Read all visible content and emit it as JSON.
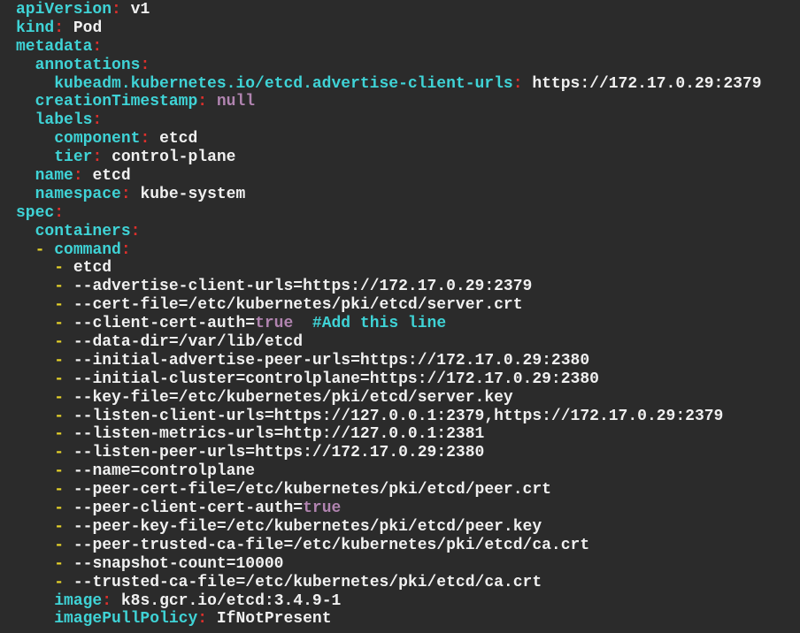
{
  "colors": {
    "background": "#2b2b2b",
    "key": "#3fd3d6",
    "colon": "#e0302c",
    "dash": "#e6d22a",
    "literal": "#b184b0",
    "text": "#f0f0f0"
  },
  "lines": [
    {
      "indent": 0,
      "key": "apiVersion",
      "value": "v1"
    },
    {
      "indent": 0,
      "key": "kind",
      "value": "Pod"
    },
    {
      "indent": 0,
      "key": "metadata"
    },
    {
      "indent": 1,
      "key": "annotations"
    },
    {
      "indent": 2,
      "key": "kubeadm.kubernetes.io/etcd.advertise-client-urls",
      "value": "https://172.17.0.29:2379"
    },
    {
      "indent": 1,
      "key": "creationTimestamp",
      "literal": "null"
    },
    {
      "indent": 1,
      "key": "labels"
    },
    {
      "indent": 2,
      "key": "component",
      "value": "etcd"
    },
    {
      "indent": 2,
      "key": "tier",
      "value": "control-plane"
    },
    {
      "indent": 1,
      "key": "name",
      "value": "etcd"
    },
    {
      "indent": 1,
      "key": "namespace",
      "value": "kube-system"
    },
    {
      "indent": 0,
      "key": "spec"
    },
    {
      "indent": 1,
      "key": "containers"
    },
    {
      "indent": 1,
      "dash": true,
      "key": "command"
    },
    {
      "indent": 2,
      "dash": true,
      "value": "etcd"
    },
    {
      "indent": 2,
      "dash": true,
      "value": "--advertise-client-urls=https://172.17.0.29:2379"
    },
    {
      "indent": 2,
      "dash": true,
      "value": "--cert-file=/etc/kubernetes/pki/etcd/server.crt"
    },
    {
      "indent": 2,
      "dash": true,
      "value": "--client-cert-auth=",
      "literal": "true",
      "comment": "  #Add this line"
    },
    {
      "indent": 2,
      "dash": true,
      "value": "--data-dir=/var/lib/etcd"
    },
    {
      "indent": 2,
      "dash": true,
      "value": "--initial-advertise-peer-urls=https://172.17.0.29:2380"
    },
    {
      "indent": 2,
      "dash": true,
      "value": "--initial-cluster=controlplane=https://172.17.0.29:2380"
    },
    {
      "indent": 2,
      "dash": true,
      "value": "--key-file=/etc/kubernetes/pki/etcd/server.key"
    },
    {
      "indent": 2,
      "dash": true,
      "value": "--listen-client-urls=https://127.0.0.1:2379,https://172.17.0.29:2379"
    },
    {
      "indent": 2,
      "dash": true,
      "value": "--listen-metrics-urls=http://127.0.0.1:2381"
    },
    {
      "indent": 2,
      "dash": true,
      "value": "--listen-peer-urls=https://172.17.0.29:2380"
    },
    {
      "indent": 2,
      "dash": true,
      "value": "--name=controlplane"
    },
    {
      "indent": 2,
      "dash": true,
      "value": "--peer-cert-file=/etc/kubernetes/pki/etcd/peer.crt"
    },
    {
      "indent": 2,
      "dash": true,
      "value": "--peer-client-cert-auth=",
      "literal": "true"
    },
    {
      "indent": 2,
      "dash": true,
      "value": "--peer-key-file=/etc/kubernetes/pki/etcd/peer.key"
    },
    {
      "indent": 2,
      "dash": true,
      "value": "--peer-trusted-ca-file=/etc/kubernetes/pki/etcd/ca.crt"
    },
    {
      "indent": 2,
      "dash": true,
      "value": "--snapshot-count=10000"
    },
    {
      "indent": 2,
      "dash": true,
      "value": "--trusted-ca-file=/etc/kubernetes/pki/etcd/ca.crt"
    },
    {
      "indent": 2,
      "key": "image",
      "value": "k8s.gcr.io/etcd:3.4.9-1"
    },
    {
      "indent": 2,
      "key": "imagePullPolicy",
      "value": "IfNotPresent"
    }
  ]
}
